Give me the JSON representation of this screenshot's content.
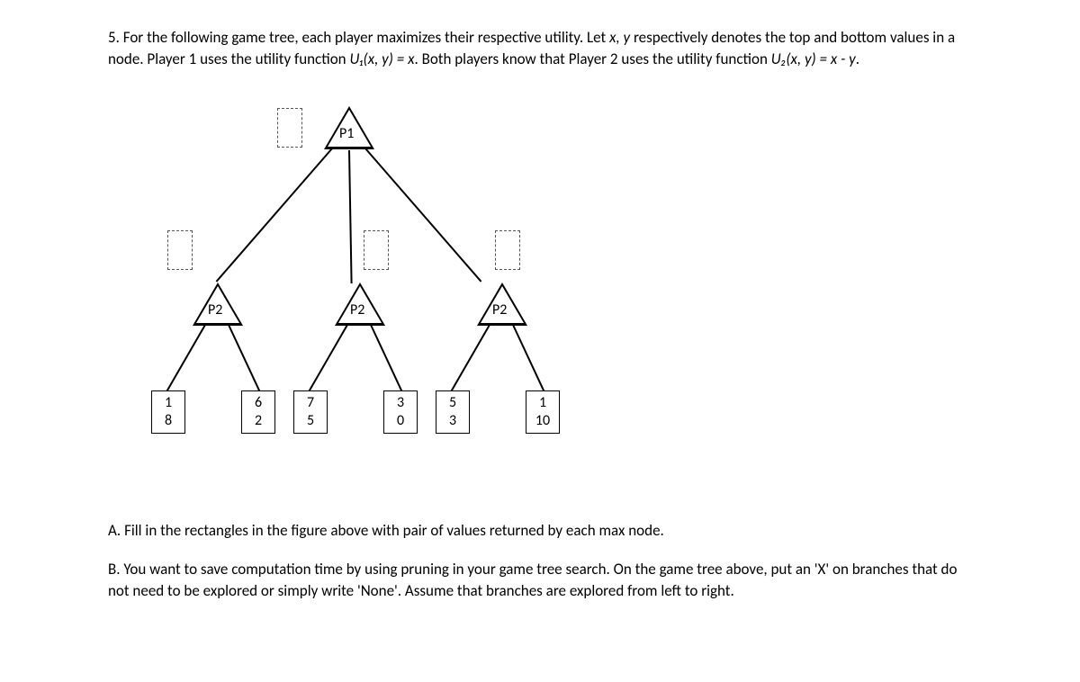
{
  "problem": {
    "number": "5.",
    "intro_a": "For the following game tree, each player maximizes their respective utility. Let ",
    "xy": "x, y",
    "intro_b": " respectively denotes the top and bottom values in a node. Player 1 uses the utility function ",
    "u1": "U₁(x, y) = x",
    "intro_c": ". Both players know that Player 2 uses the utility function ",
    "u2": "U₂(x, y) = x - y",
    "intro_d": "."
  },
  "tree": {
    "root_label": "P1",
    "p2_label": "P2",
    "leaves": [
      {
        "top": "1",
        "bottom": "8"
      },
      {
        "top": "6",
        "bottom": "2"
      },
      {
        "top": "7",
        "bottom": "5"
      },
      {
        "top": "3",
        "bottom": "0"
      },
      {
        "top": "5",
        "bottom": "3"
      },
      {
        "top": "1",
        "bottom": "10"
      }
    ]
  },
  "parts": {
    "a": "A. Fill in the rectangles in the figure above with pair of values returned by each max node.",
    "b": "B. You want to save computation time by using pruning in your game tree search. On the game tree above, put an 'X' on branches that do not need to be explored or simply write 'None'. Assume that branches are explored from left to right."
  }
}
